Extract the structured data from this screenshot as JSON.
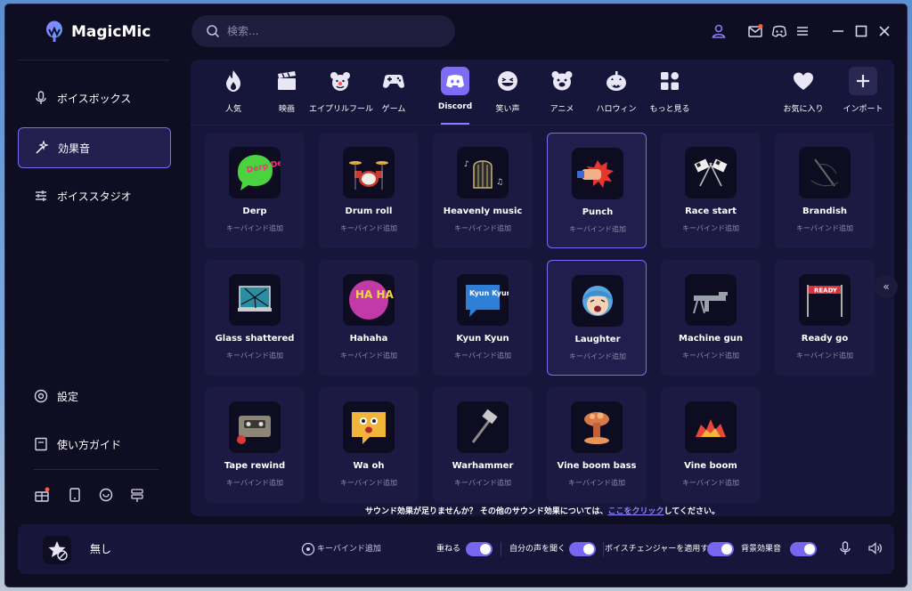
{
  "app": {
    "name": "MagicMic"
  },
  "search": {
    "placeholder": "検索..."
  },
  "sidebar": {
    "items": [
      {
        "label": "ボイスボックス"
      },
      {
        "label": "効果音"
      },
      {
        "label": "ボイススタジオ"
      },
      {
        "label": "設定"
      },
      {
        "label": "使い方ガイド"
      }
    ]
  },
  "categories": [
    {
      "label": "人気",
      "icon": "flame-icon"
    },
    {
      "label": "映画",
      "icon": "clapperboard-icon"
    },
    {
      "label": "エイプリルフール",
      "icon": "clown-icon"
    },
    {
      "label": "ゲーム",
      "icon": "gamepad-icon"
    },
    {
      "label": "Discord",
      "icon": "discord-icon"
    },
    {
      "label": "笑い声",
      "icon": "laughing-face-icon"
    },
    {
      "label": "アニメ",
      "icon": "bear-icon"
    },
    {
      "label": "ハロウィン",
      "icon": "pumpkin-icon"
    },
    {
      "label": "もっと見る",
      "icon": "grid-icon"
    },
    {
      "label": "お気に入り",
      "icon": "heart-icon"
    },
    {
      "label": "インポート",
      "icon": "plus-icon"
    }
  ],
  "sounds": [
    {
      "name": "Derp",
      "sub": "キーバインド追加"
    },
    {
      "name": "Drum roll",
      "sub": "キーバインド追加"
    },
    {
      "name": "Heavenly music",
      "sub": "キーバインド追加"
    },
    {
      "name": "Punch",
      "sub": "キーバインド追加"
    },
    {
      "name": "Race start",
      "sub": "キーバインド追加"
    },
    {
      "name": "Brandish",
      "sub": "キーバインド追加"
    },
    {
      "name": "Glass shattered",
      "sub": "キーバインド追加"
    },
    {
      "name": "Hahaha",
      "sub": "キーバインド追加"
    },
    {
      "name": "Kyun Kyun",
      "sub": "キーバインド追加"
    },
    {
      "name": "Laughter",
      "sub": "キーバインド追加"
    },
    {
      "name": "Machine gun",
      "sub": "キーバインド追加"
    },
    {
      "name": "Ready go",
      "sub": "キーバインド追加"
    },
    {
      "name": "Tape rewind",
      "sub": "キーバインド追加"
    },
    {
      "name": "Wa oh",
      "sub": "キーバインド追加"
    },
    {
      "name": "Warhammer",
      "sub": "キーバインド追加"
    },
    {
      "name": "Vine boom bass",
      "sub": "キーバインド追加"
    },
    {
      "name": "Vine boom",
      "sub": "キーバインド追加"
    }
  ],
  "thumb_text": {
    "derp": "Derp Derp",
    "haha": "HA HA!",
    "kyun": "Kyun Kyun",
    "ready": "READY"
  },
  "footer": {
    "text": "サウンド効果が足りませんか？ その他のサウンド効果については、",
    "link": "ここをクリック",
    "suffix": "してください。"
  },
  "bottom": {
    "current": "無し",
    "keybind": "キーバインド追加",
    "toggles": [
      {
        "label": "重ねる",
        "on": true
      },
      {
        "label": "自分の声を聞く",
        "on": true
      },
      {
        "label": "ボイスチェンジャーを適用する",
        "on": true
      },
      {
        "label": "背景効果音",
        "on": true
      }
    ]
  },
  "colors": {
    "accent": "#7865f0",
    "background": "#0e0d22",
    "panel": "#16153a",
    "discord": "#5865f2"
  }
}
